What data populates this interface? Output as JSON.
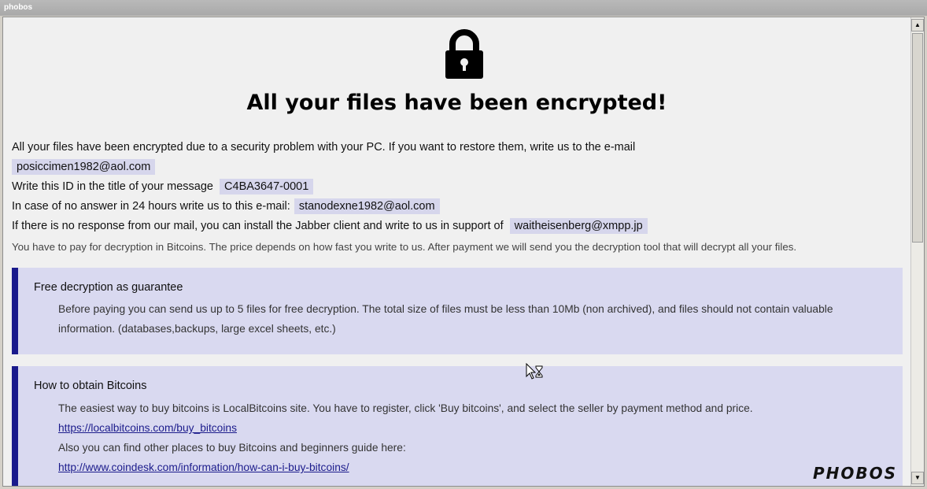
{
  "window": {
    "title": "phobos"
  },
  "header": {
    "lock_icon": "lock-icon",
    "headline": "All your files have been encrypted!"
  },
  "body": {
    "line1": "All your files have been encrypted due to a security problem with your PC. If you want to restore them, write us to the e-mail",
    "email1": "posiccimen1982@aol.com",
    "id_label": "Write this ID in the title of your message",
    "id_value": "C4BA3647-0001",
    "fallback_label": "In case of no answer in 24 hours write us to this e-mail:",
    "email2": "stanodexne1982@aol.com",
    "jabber_label": "If there is no response from our mail, you can install the Jabber client and write to us in support of",
    "jabber_value": "waitheisenberg@xmpp.jp",
    "payment_note": "You have to pay for decryption in Bitcoins. The price depends on how fast you write to us. After payment we will send you the decryption tool that will decrypt all your files."
  },
  "guarantee": {
    "title": "Free decryption as guarantee",
    "text": "Before paying you can send us up to 5 files for free decryption. The total size of files must be less than 10Mb (non archived), and files should not contain valuable information. (databases,backups, large excel sheets, etc.)"
  },
  "bitcoins": {
    "title": "How to obtain Bitcoins",
    "text1": "The easiest way to buy bitcoins is LocalBitcoins site. You have to register, click 'Buy bitcoins', and select the seller by payment method and price.",
    "link1": "https://localbitcoins.com/buy_bitcoins",
    "text2": "Also you can find other places to buy Bitcoins and beginners guide here:",
    "link2": "http://www.coindesk.com/information/how-can-i-buy-bitcoins/"
  },
  "branding": {
    "logo_text": "PHOBOS"
  },
  "colors": {
    "accent_bar": "#1a1a8c",
    "box_bg": "#d9d9f0",
    "highlight_bg": "#d6d6ec"
  }
}
